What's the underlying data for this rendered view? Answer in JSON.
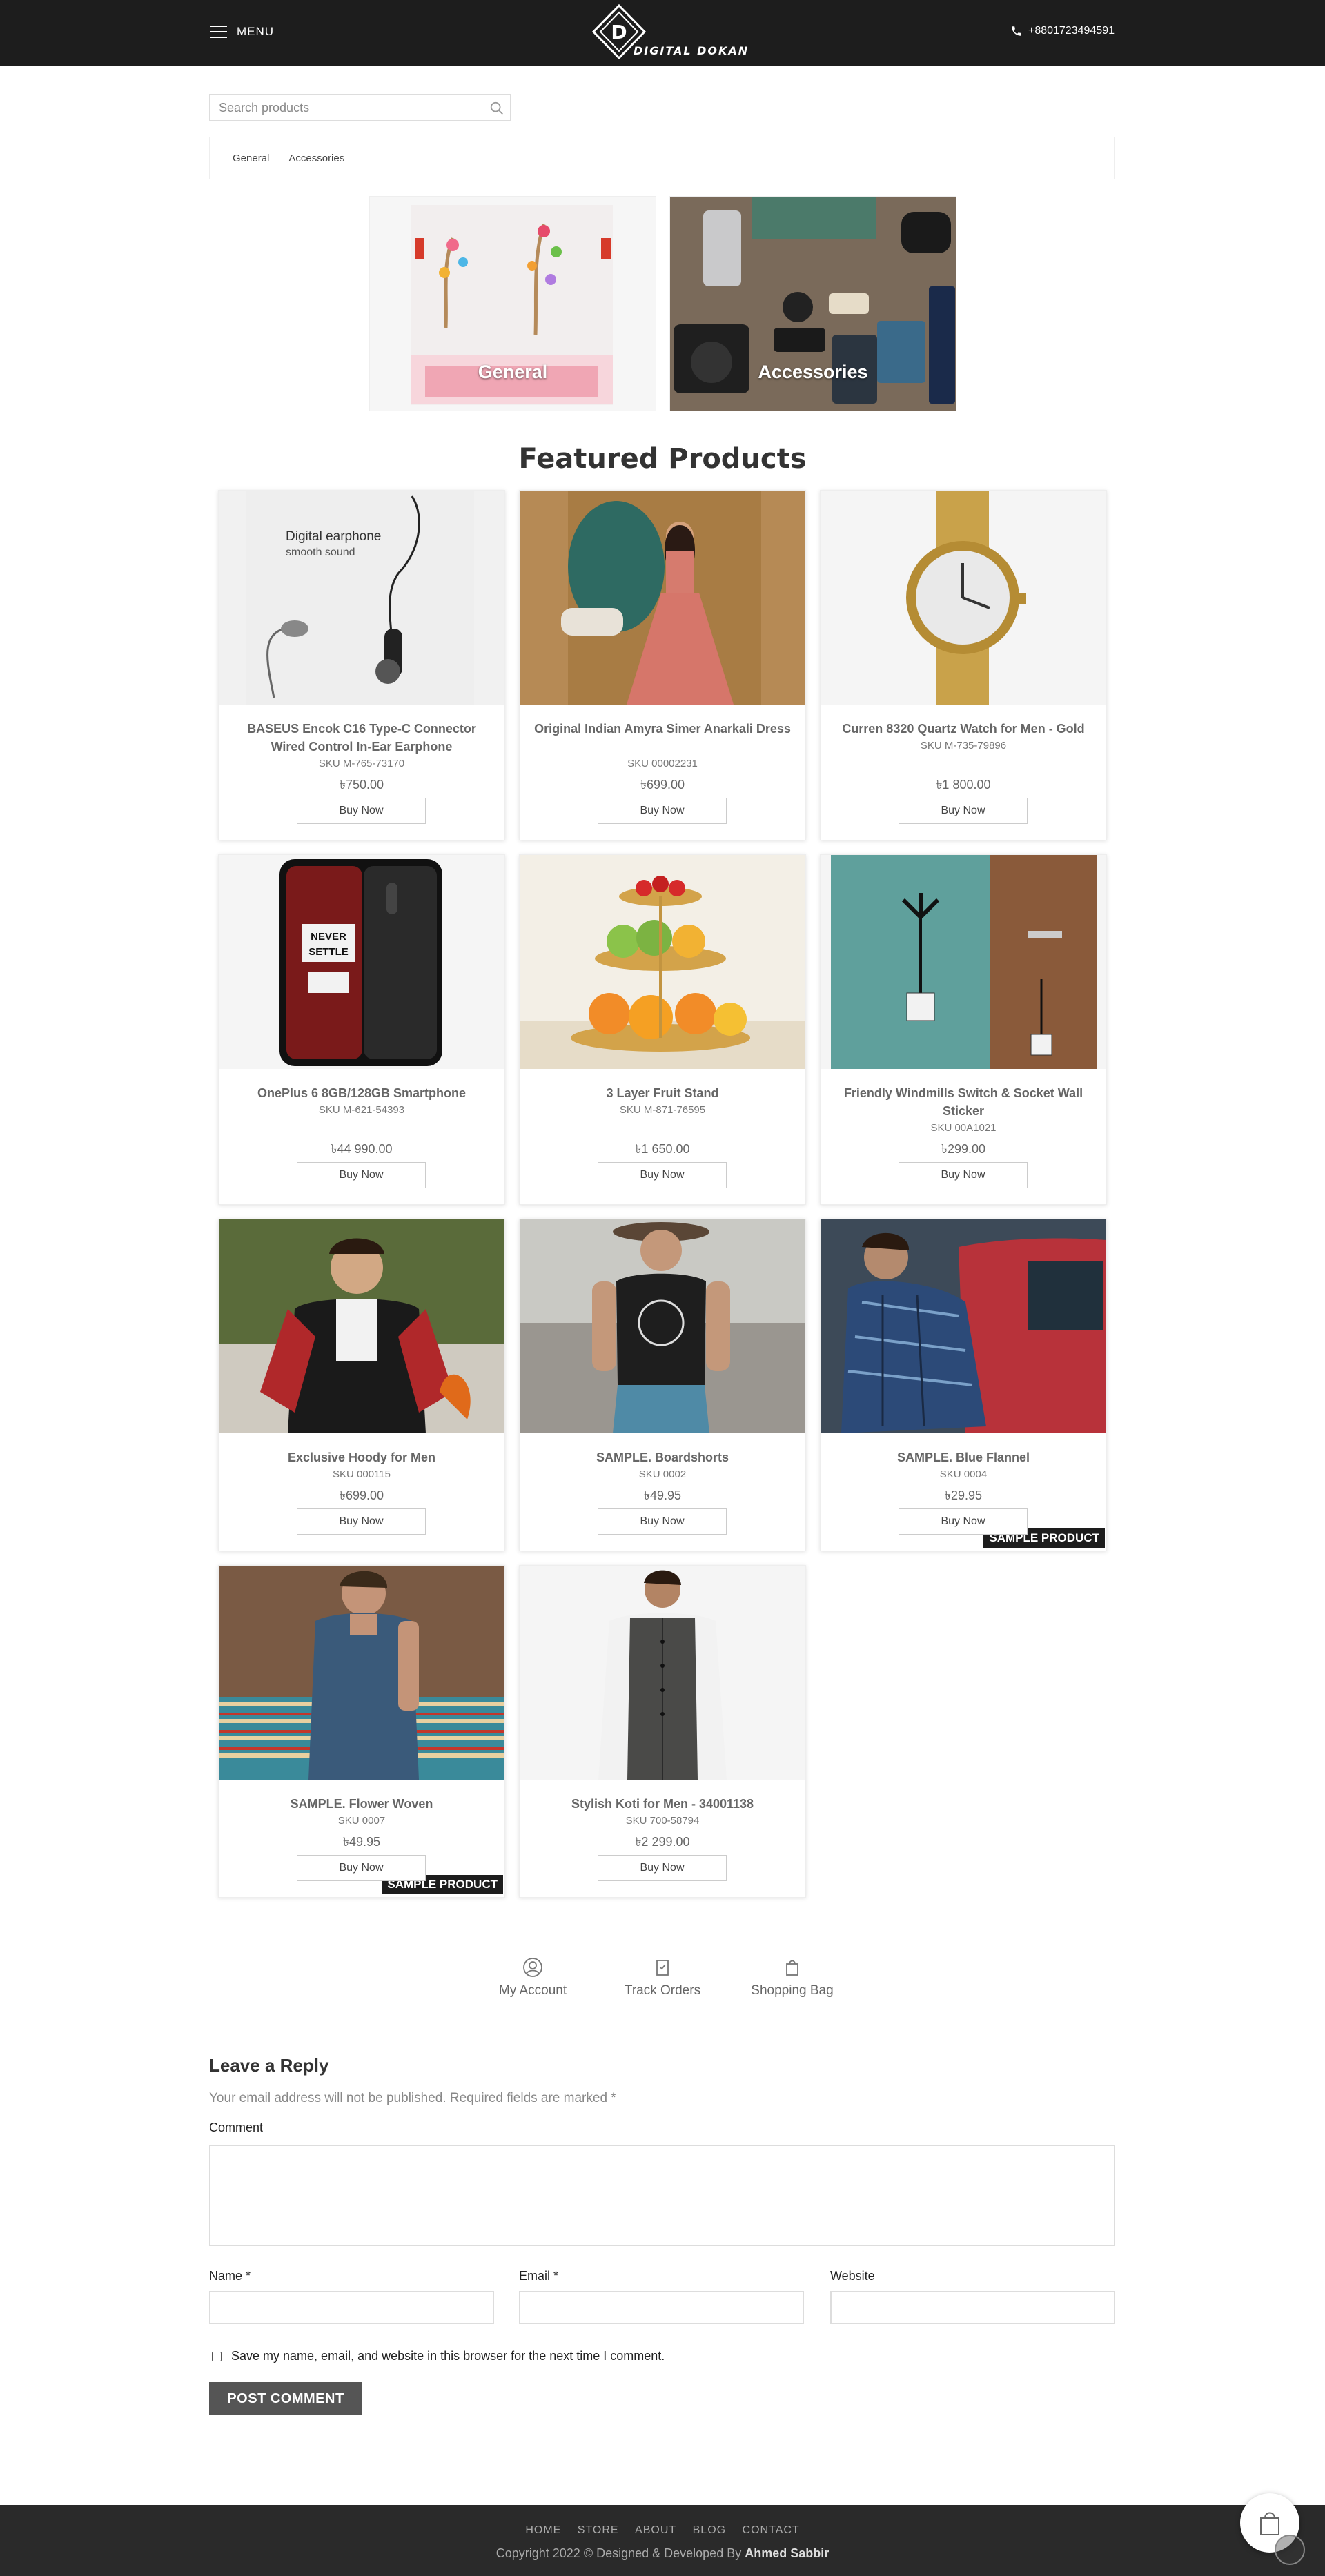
{
  "header": {
    "menu_label": "MENU",
    "logo_letter": "D",
    "logo_text": "DIGITAL DOKAN",
    "phone": "+8801723494591"
  },
  "search": {
    "placeholder": "Search products"
  },
  "category_tabs": [
    "General",
    "Accessories"
  ],
  "category_tiles": [
    {
      "label": "General"
    },
    {
      "label": "Accessories"
    }
  ],
  "featured": {
    "title": "Featured Products",
    "buy_label": "Buy Now",
    "products": [
      {
        "name": "BASEUS Encok C16 Type-C Connector Wired Control In-Ear Earphone",
        "sku": "SKU M-765-73170",
        "price": "৳750.00"
      },
      {
        "name": "Original Indian Amyra Simer Anarkali Dress",
        "sku": "SKU 00002231",
        "price": "৳699.00"
      },
      {
        "name": "Curren 8320 Quartz Watch for Men - Gold",
        "sku": "SKU M-735-79896",
        "price": "৳1 800.00"
      },
      {
        "name": "OnePlus 6 8GB/128GB Smartphone",
        "sku": "SKU M-621-54393",
        "price": "৳44 990.00"
      },
      {
        "name": "3 Layer Fruit Stand",
        "sku": "SKU M-871-76595",
        "price": "৳1 650.00"
      },
      {
        "name": "Friendly Windmills Switch & Socket Wall Sticker",
        "sku": "SKU 00A1021",
        "price": "৳299.00"
      },
      {
        "name": "Exclusive Hoody for Men",
        "sku": "SKU 000115",
        "price": "৳699.00"
      },
      {
        "name": "SAMPLE. Boardshorts",
        "sku": "SKU 0002",
        "price": "৳49.95"
      },
      {
        "name": "SAMPLE. Blue Flannel",
        "sku": "SKU 0004",
        "price": "৳29.95",
        "badge": "SAMPLE PRODUCT"
      },
      {
        "name": "SAMPLE. Flower Woven",
        "sku": "SKU 0007",
        "price": "৳49.95",
        "badge": "SAMPLE PRODUCT"
      },
      {
        "name": "Stylish Koti for Men - 34001138",
        "sku": "SKU 700-58794",
        "price": "৳2 299.00"
      }
    ],
    "image_text": {
      "earphone_headline": "Digital earphone",
      "earphone_sub": "smooth sound",
      "phone_text_1": "NEVER",
      "phone_text_2": "SETTLE"
    }
  },
  "account_nav": {
    "my_account": "My Account",
    "track_orders": "Track Orders",
    "shopping_bag": "Shopping Bag"
  },
  "reply": {
    "title": "Leave a Reply",
    "note": "Your email address will not be published. Required fields are marked *",
    "comment_label": "Comment",
    "name_label": "Name *",
    "email_label": "Email *",
    "website_label": "Website",
    "save_label": "Save my name, email, and website in this browser for the next time I comment.",
    "post_label": "POST COMMENT"
  },
  "footer": {
    "links": [
      "HOME",
      "STORE",
      "ABOUT",
      "BLOG",
      "CONTACT"
    ],
    "copyright_prefix": "Copyright 2022 © Designed & Developed By",
    "author": "Ahmed Sabbir"
  }
}
